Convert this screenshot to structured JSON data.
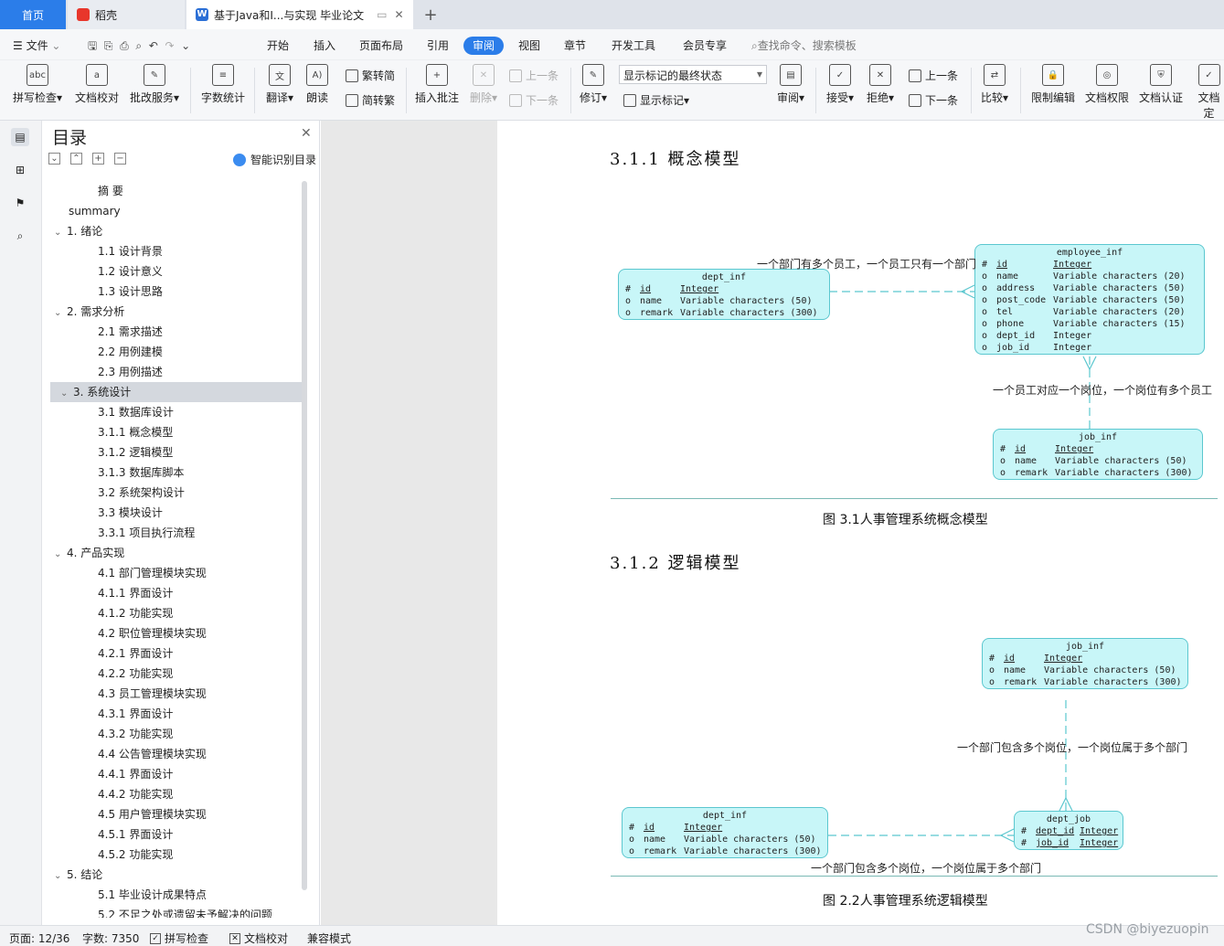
{
  "tabs": {
    "home": "首页",
    "daoke": "稻壳",
    "doc": "基于Java和I...与实现 毕业论文",
    "plus": "+"
  },
  "menu": {
    "file": "文件",
    "items": [
      "开始",
      "插入",
      "页面布局",
      "引用",
      "审阅",
      "视图",
      "章节",
      "开发工具",
      "会员专享"
    ],
    "search": "查找命令、搜索模板"
  },
  "ribbon": {
    "spellcheck": "拼写检查",
    "doc_check": "文档校对",
    "batch": "批改服务",
    "word_count": "字数统计",
    "translate": "翻译",
    "read_aloud": "朗读",
    "fan_to_jian": "繁转简",
    "jian_to_fan": "简转繁",
    "insert_comment": "插入批注",
    "delete": "删除",
    "prev": "上一条",
    "next": "下一条",
    "revise": "修订",
    "markup_state": "显示标记的最终状态",
    "show_markup": "显示标记",
    "review": "审阅",
    "accept": "接受",
    "reject": "拒绝",
    "prev2": "上一条",
    "next2": "下一条",
    "compare": "比较",
    "restrict": "限制编辑",
    "perm": "文档权限",
    "auth": "文档认证",
    "more": "文档定"
  },
  "toc": {
    "title": "目录",
    "smart": "智能识别目录",
    "items": [
      {
        "label": "摘 要",
        "level": "center"
      },
      {
        "label": "summary",
        "level": 0
      },
      {
        "label": "1.   绪论",
        "level": 0,
        "chev": "v"
      },
      {
        "label": "1.1 设计背景",
        "level": 2
      },
      {
        "label": "1.2 设计意义",
        "level": 2
      },
      {
        "label": "1.3 设计思路",
        "level": 2
      },
      {
        "label": "2. 需求分析",
        "level": 0,
        "chev": "v"
      },
      {
        "label": "2.1 需求描述",
        "level": 2
      },
      {
        "label": "2.2 用例建模",
        "level": 2
      },
      {
        "label": "2.3 用例描述",
        "level": 2
      },
      {
        "label": "3. 系统设计",
        "level": 0,
        "chev": "v",
        "selected": true
      },
      {
        "label": "3.1 数据库设计",
        "level": 2
      },
      {
        "label": "3.1.1 概念模型",
        "level": 2
      },
      {
        "label": "3.1.2 逻辑模型",
        "level": 2
      },
      {
        "label": "3.1.3 数据库脚本",
        "level": 2
      },
      {
        "label": "3.2 系统架构设计",
        "level": 2
      },
      {
        "label": "3.3 模块设计",
        "level": 2
      },
      {
        "label": "3.3.1 项目执行流程",
        "level": 2
      },
      {
        "label": "4. 产品实现",
        "level": 0,
        "chev": "v"
      },
      {
        "label": "4.1 部门管理模块实现",
        "level": 2
      },
      {
        "label": "4.1.1 界面设计",
        "level": 2
      },
      {
        "label": "4.1.2 功能实现",
        "level": 2
      },
      {
        "label": "4.2 职位管理模块实现",
        "level": 2
      },
      {
        "label": "4.2.1 界面设计",
        "level": 2
      },
      {
        "label": "4.2.2 功能实现",
        "level": 2
      },
      {
        "label": "4.3 员工管理模块实现",
        "level": 2
      },
      {
        "label": "4.3.1 界面设计",
        "level": 2
      },
      {
        "label": "4.3.2 功能实现",
        "level": 2
      },
      {
        "label": "4.4 公告管理模块实现",
        "level": 2
      },
      {
        "label": "4.4.1 界面设计",
        "level": 2
      },
      {
        "label": "4.4.2 功能实现",
        "level": 2
      },
      {
        "label": "4.5 用户管理模块实现",
        "level": 2
      },
      {
        "label": "4.5.1 界面设计",
        "level": 2
      },
      {
        "label": "4.5.2 功能实现",
        "level": 2
      },
      {
        "label": "5. 结论",
        "level": 0,
        "chev": "v"
      },
      {
        "label": "5.1 毕业设计成果特点",
        "level": 2
      },
      {
        "label": "5.2 不足之处或遗留未予解决的问题",
        "level": 2
      }
    ]
  },
  "doc": {
    "h1": "3.1.1 概念模型",
    "h2": "3.1.2 逻辑模型",
    "cap1": "图 3.1人事管理系统概念模型",
    "cap2": "图 2.2人事管理系统逻辑模型",
    "d1": {
      "dept": {
        "name": "dept_inf",
        "rows": [
          [
            "#",
            "id",
            "Integer",
            true
          ],
          [
            "o",
            "name",
            "Variable characters (50)",
            false
          ],
          [
            "o",
            "remark",
            "Variable characters (300)",
            false
          ]
        ]
      },
      "emp": {
        "name": "employee_inf",
        "rows": [
          [
            "#",
            "id",
            "Integer",
            true
          ],
          [
            "o",
            "name",
            "Variable characters (20)",
            false
          ],
          [
            "o",
            "address",
            "Variable characters (50)",
            false
          ],
          [
            "o",
            "post_code",
            "Variable characters (50)",
            false
          ],
          [
            "o",
            "tel",
            "Variable characters (20)",
            false
          ],
          [
            "o",
            "phone",
            "Variable characters (15)",
            false
          ],
          [
            "o",
            "dept_id",
            "Integer",
            false
          ],
          [
            "o",
            "job_id",
            "Integer",
            false
          ]
        ]
      },
      "job": {
        "name": "job_inf",
        "rows": [
          [
            "#",
            "id",
            "Integer",
            true
          ],
          [
            "o",
            "name",
            "Variable characters (50)",
            false
          ],
          [
            "o",
            "remark",
            "Variable characters (300)",
            false
          ]
        ]
      },
      "rel1": "一个部门有多个员工，一个员工只有一个部门",
      "rel2": "一个员工对应一个岗位，一个岗位有多个员工"
    },
    "d2": {
      "job": {
        "name": "job_inf",
        "rows": [
          [
            "#",
            "id",
            "Integer",
            true
          ],
          [
            "o",
            "name",
            "Variable characters (50)",
            false
          ],
          [
            "o",
            "remark",
            "Variable characters (300)",
            false
          ]
        ]
      },
      "dept": {
        "name": "dept_inf",
        "rows": [
          [
            "#",
            "id",
            "Integer",
            true
          ],
          [
            "o",
            "name",
            "Variable characters (50)",
            false
          ],
          [
            "o",
            "remark",
            "Variable characters (300)",
            false
          ]
        ]
      },
      "djob": {
        "name": "dept_job",
        "rows": [
          [
            "#",
            "dept_id",
            "Integer",
            true
          ],
          [
            "#",
            "job_id",
            "Integer",
            true
          ]
        ]
      },
      "rel1": "一个部门包含多个岗位，一个岗位属于多个部门",
      "rel2": "一个部门包含多个岗位，一个岗位属于多个部门"
    }
  },
  "status": {
    "page": "页面: 12/36",
    "words": "字数: 7350",
    "spell": "拼写检查",
    "check": "文档校对",
    "compat": "兼容模式"
  },
  "watermark": "CSDN @biyezuopin"
}
